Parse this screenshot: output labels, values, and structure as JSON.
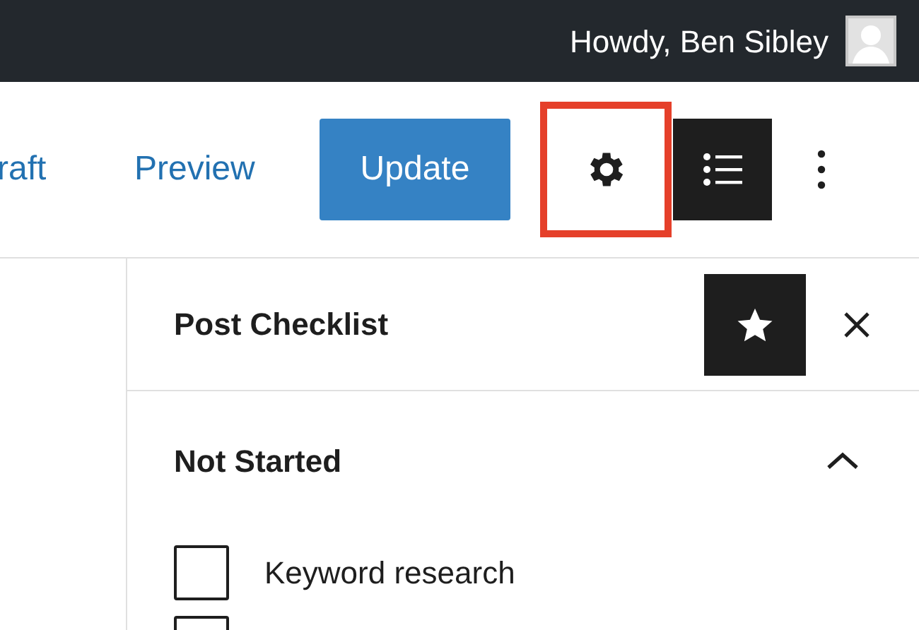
{
  "admin_bar": {
    "greeting": "Howdy, Ben Sibley"
  },
  "toolbar": {
    "save_draft": "raft",
    "preview": "Preview",
    "update": "Update",
    "settings_highlighted": true
  },
  "sidebar": {
    "title": "Post Checklist",
    "section": {
      "title": "Not Started",
      "expanded": true,
      "items": [
        {
          "label": "Keyword research",
          "checked": false
        },
        {
          "checked": false
        }
      ]
    }
  }
}
